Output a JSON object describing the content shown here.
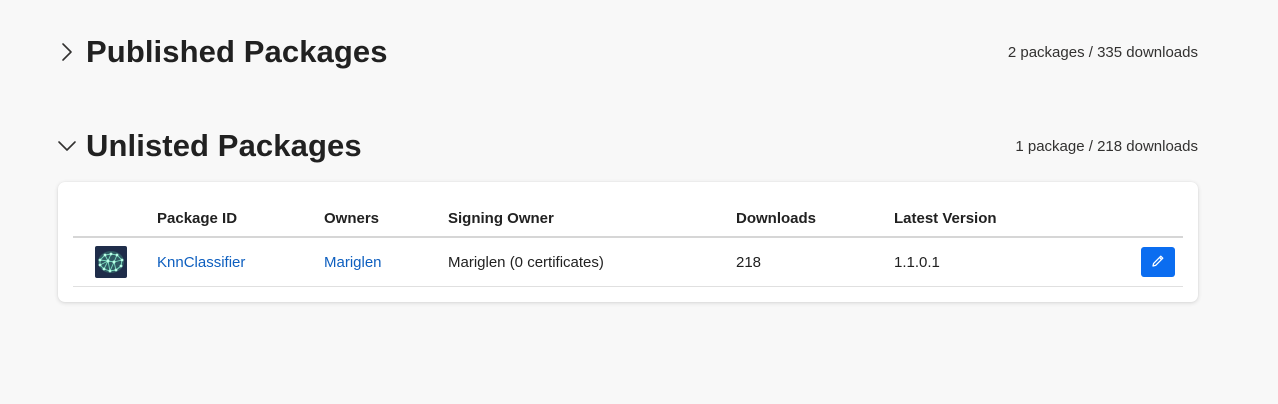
{
  "published": {
    "title": "Published Packages",
    "stats": "2 packages / 335 downloads",
    "expanded": false
  },
  "unlisted": {
    "title": "Unlisted Packages",
    "stats": "1 package / 218 downloads",
    "expanded": true,
    "table": {
      "headers": {
        "package_id": "Package ID",
        "owners": "Owners",
        "signing_owner": "Signing Owner",
        "downloads": "Downloads",
        "latest_version": "Latest Version"
      },
      "rows": [
        {
          "icon": "neural-network-package-icon",
          "package_id": "KnnClassifier",
          "owners": "Mariglen",
          "signing_owner": "Mariglen (0 certificates)",
          "downloads": "218",
          "latest_version": "1.1.0.1",
          "action_icon": "pencil-icon"
        }
      ]
    }
  },
  "colors": {
    "background": "#f8f8f8",
    "link": "#0e5fbf",
    "button": "#0b6df0"
  }
}
